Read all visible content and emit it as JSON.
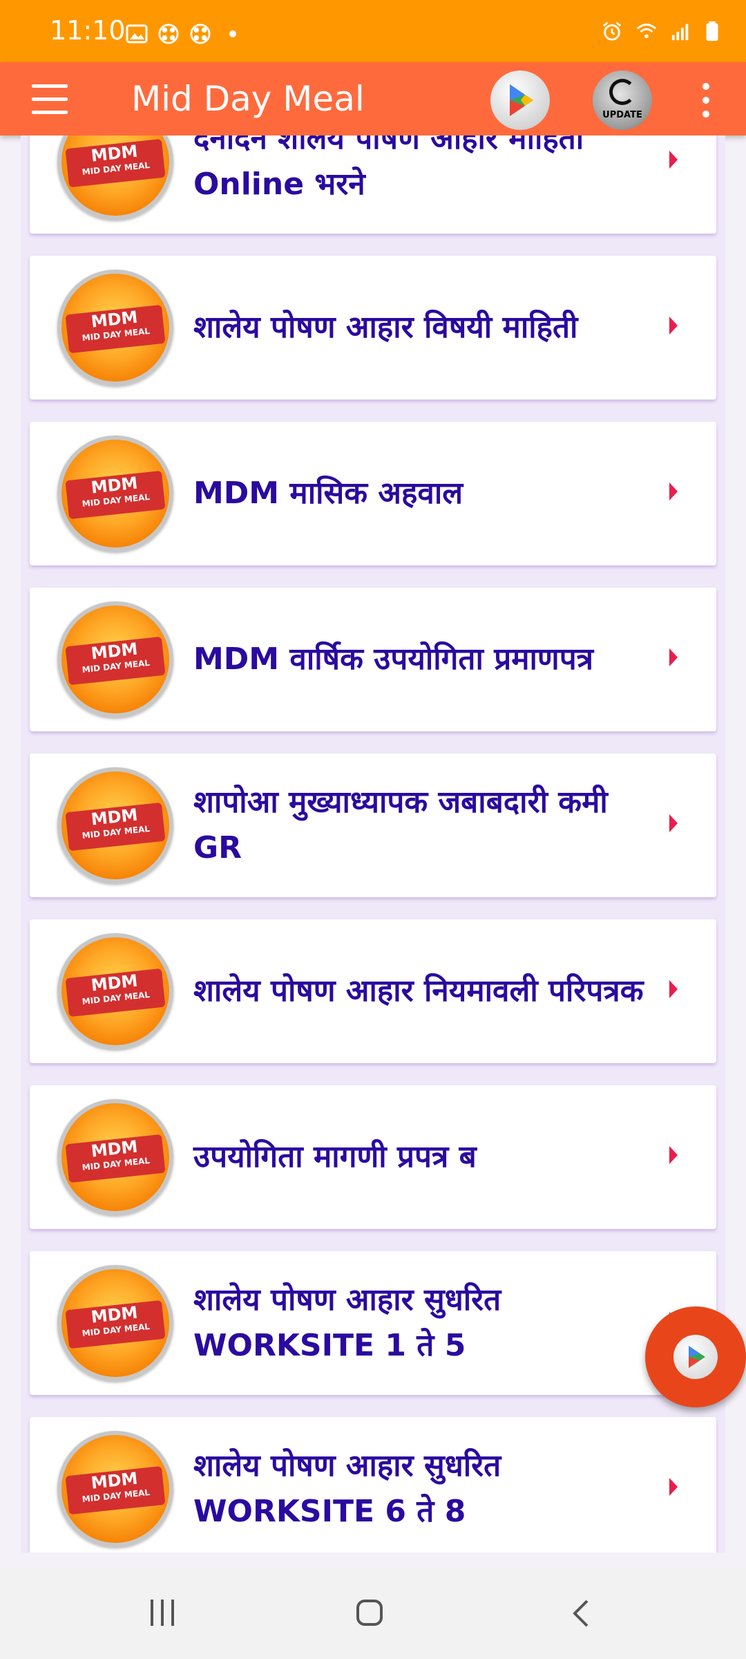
{
  "status_bar": {
    "time": "11:10",
    "left_icons": [
      "image-icon",
      "pinwheel-icon",
      "pinwheel-icon",
      "notification-dot"
    ],
    "right_icons": [
      "alarm-icon",
      "wifi-icon",
      "signal-icon",
      "battery-icon"
    ]
  },
  "app_bar": {
    "title": "Mid Day Meal",
    "play_icon_caption": "Google play",
    "update_label": "UPDATE",
    "menu_icon": "hamburger-menu-icon",
    "overflow_icon": "more-vert-icon"
  },
  "badge": {
    "line1": "MDM",
    "line2": "MID DAY MEAL"
  },
  "items": [
    {
      "label": "दैनंदिन शालेय पोषण आहार माहिती Online भरने"
    },
    {
      "label": "शालेय पोषण आहार विषयी माहिती"
    },
    {
      "label": "MDM मासिक अहवाल"
    },
    {
      "label": "MDM वार्षिक उपयोगिता प्रमाणपत्र"
    },
    {
      "label": "शापोआ मुख्याध्यापक जबाबदारी कमी GR"
    },
    {
      "label": "शालेय पोषण आहार नियमावली परिपत्रक"
    },
    {
      "label": "उपयोगिता मागणी प्रपत्र ब"
    },
    {
      "label": "शालेय पोषण आहार सुधरित WORKSITE 1 ते 5"
    },
    {
      "label": "शालेय पोषण आहार सुधरित WORKSITE 6 ते 8"
    }
  ],
  "colors": {
    "status_bar": "#FF9800",
    "app_bar": "#FF6A3D",
    "item_text": "#2a0aa0",
    "chevron": "#e91e4c",
    "fab": "#e8461a"
  },
  "fab": {
    "icon": "google-play-icon"
  },
  "nav_bar": {
    "buttons": [
      "recents-icon",
      "home-icon",
      "back-icon"
    ]
  }
}
